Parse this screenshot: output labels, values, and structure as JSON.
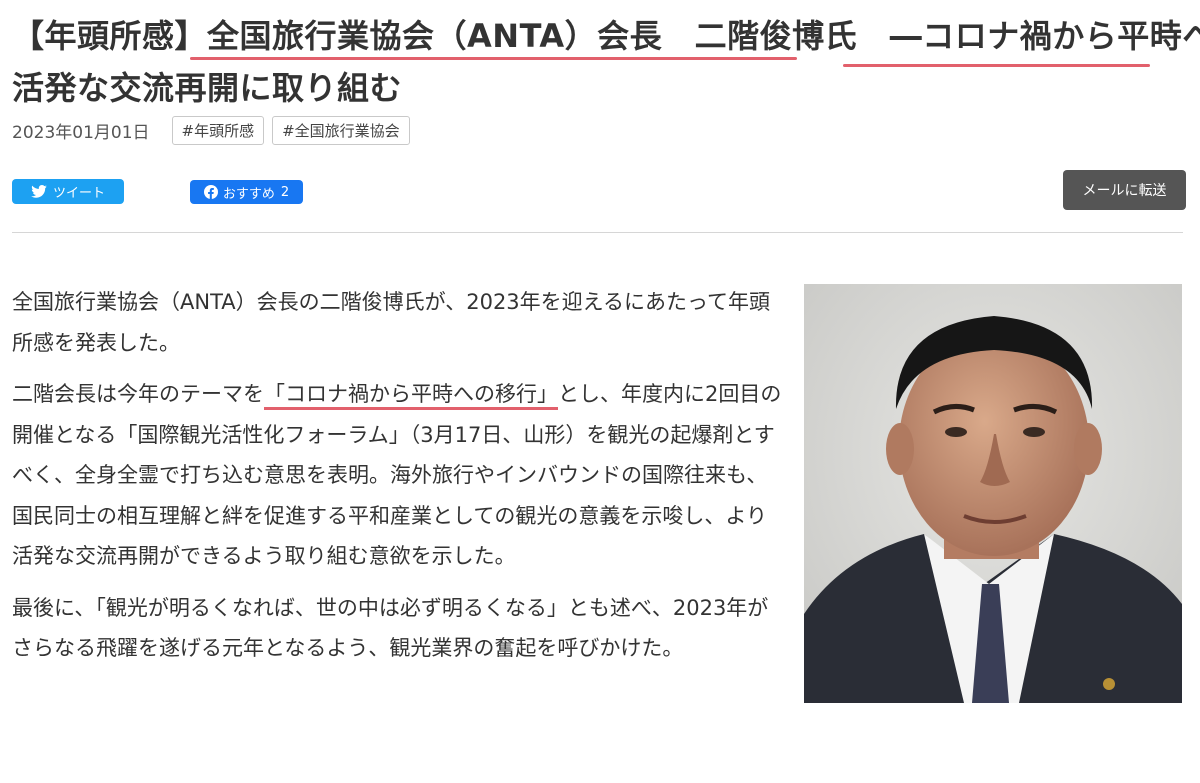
{
  "article": {
    "title_prefix": "【年頭所感】",
    "title_main": "全国旅行業協会（ANTA）会長　二階俊博氏",
    "title_spacer": "　",
    "title_sub": "―コロナ禍から平時へ、",
    "title_line2": "活発な交流再開に取り組む",
    "date": "2023年01月01日",
    "tags": [
      "#年頭所感",
      "#全国旅行業協会"
    ]
  },
  "share": {
    "tweet_label": "ツイート",
    "fb_label": "おすすめ",
    "fb_count": "2",
    "mail_label": "メールに転送"
  },
  "body": {
    "p1": "全国旅行業協会（ANTA）会長の二階俊博氏が、2023年を迎えるにあたって年頭所感を発表した。",
    "p2_before": "二階会長は今年のテーマを",
    "p2_highlight": "「コロナ禍から平時への移行」",
    "p2_after": "とし、年度内に2回目の開催となる「国際観光活性化フォーラム」（3月17日、山形）を観光の起爆剤とすべく、全身全霊で打ち込む意思を表明。海外旅行やインバウンドの国際往来も、国民同士の相互理解と絆を促進する平和産業としての観光の意義を示唆し、より活発な交流再開ができるよう取り組む意欲を示した。",
    "p3": "最後に、「観光が明るくなれば、世の中は必ず明るくなる」とも述べ、2023年がさらなる飛躍を遂げる元年となるよう、観光業界の奮起を呼びかけた。"
  },
  "colors": {
    "accent_underline": "#e2606c",
    "twitter": "#1da1f2",
    "facebook": "#1877f2",
    "mail_button": "#555555"
  },
  "icons": {
    "tweet": "twitter-bird-icon",
    "fb": "facebook-logo-icon"
  }
}
